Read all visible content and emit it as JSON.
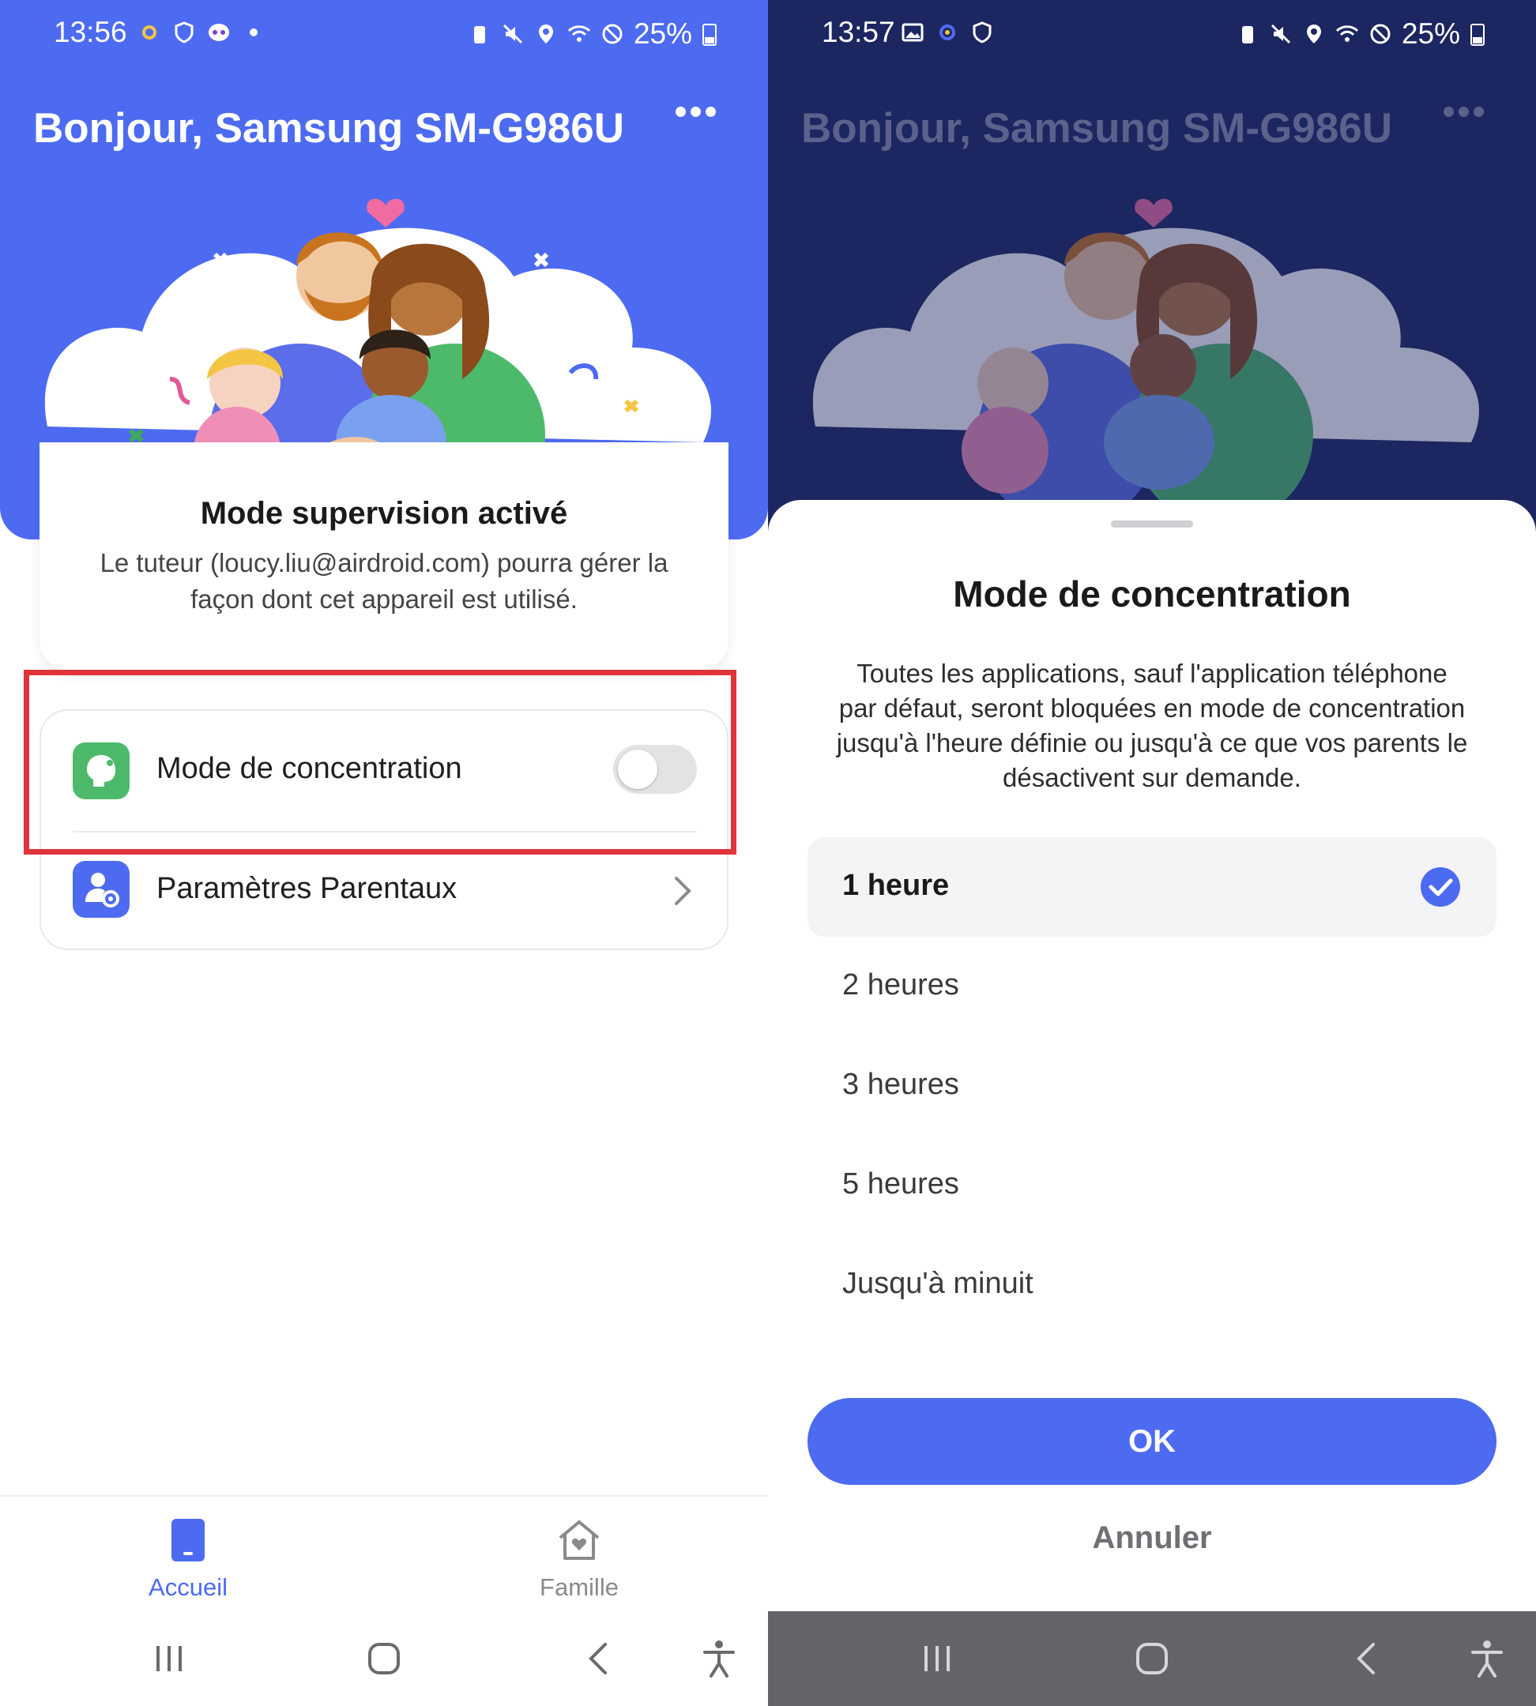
{
  "left": {
    "status": {
      "time": "13:56",
      "battery": "25%"
    },
    "header": {
      "greeting": "Bonjour, Samsung SM-G986U"
    },
    "card": {
      "title": "Mode supervision activé",
      "description_line1": "Le tuteur (loucy.liu@airdroid.com) pourra gérer la",
      "description_line2": "façon dont cet appareil est utilisé."
    },
    "list": {
      "items": [
        {
          "label": "Mode de concentration",
          "icon": "focus-head-icon",
          "toggle_on": false
        },
        {
          "label": "Paramètres Parentaux",
          "icon": "parent-settings-icon"
        }
      ]
    },
    "bottom_nav": {
      "items": [
        {
          "label": "Accueil",
          "icon": "phone-icon",
          "active": true
        },
        {
          "label": "Famille",
          "icon": "house-heart-icon",
          "active": false
        }
      ]
    }
  },
  "right": {
    "status": {
      "time": "13:57",
      "battery": "25%"
    },
    "header": {
      "greeting": "Bonjour, Samsung SM-G986U"
    },
    "sheet": {
      "title": "Mode de concentration",
      "description_lines": [
        "Toutes les applications, sauf l'application téléphone",
        "par défaut, seront bloquées en mode de concentration",
        "jusqu'à l'heure définie ou jusqu'à ce que vos parents le",
        "désactivent sur demande."
      ],
      "options": [
        {
          "label": "1 heure",
          "selected": true
        },
        {
          "label": "2 heures",
          "selected": false
        },
        {
          "label": "3 heures",
          "selected": false
        },
        {
          "label": "5 heures",
          "selected": false
        },
        {
          "label": "Jusqu'à minuit",
          "selected": false
        }
      ],
      "ok_label": "OK",
      "cancel_label": "Annuler"
    }
  },
  "colors": {
    "brand_blue": "#4d6bf0",
    "dim_overlay": "#1c2660",
    "highlight_red": "#e0333a",
    "focus_green": "#4cba6a"
  }
}
